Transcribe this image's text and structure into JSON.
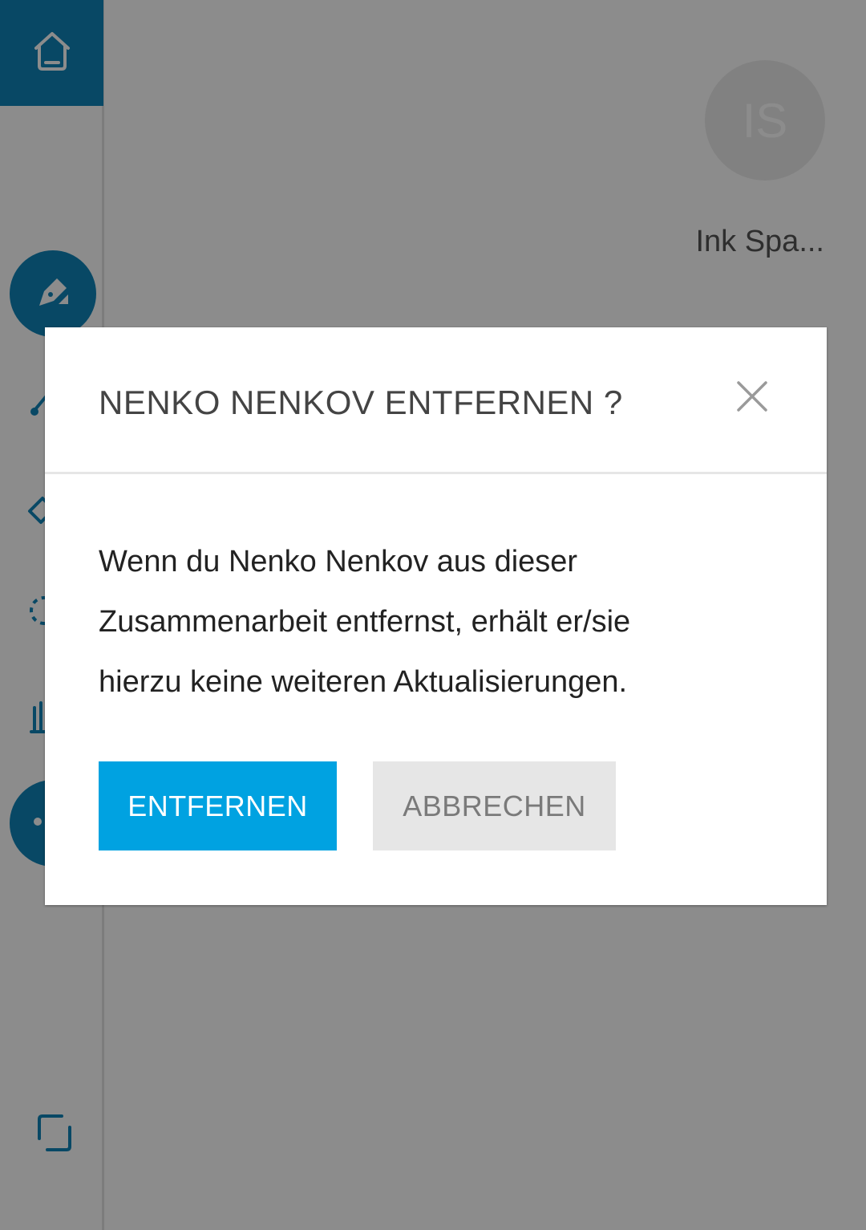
{
  "profile": {
    "initials": "IS",
    "name": "Ink Spa..."
  },
  "dialog": {
    "title": "NENKO NENKOV ENTFERNEN ?",
    "body_lines": [
      "Wenn du Nenko Nenkov aus dieser",
      "Zusammenarbeit entfernst, erhält er/sie",
      "hierzu keine weiteren Aktualisierungen."
    ],
    "confirm_label": "ENTFERNEN",
    "cancel_label": "ABBRECHEN"
  },
  "colors": {
    "accent": "#0f84b8",
    "primary_button": "#00a2e1",
    "secondary_button": "#e6e6e6"
  },
  "icons": [
    "home-icon",
    "pen-icon",
    "brush-icon",
    "eraser-icon",
    "lasso-icon",
    "hand-icon",
    "more-icon",
    "crop-icon",
    "close-icon"
  ]
}
